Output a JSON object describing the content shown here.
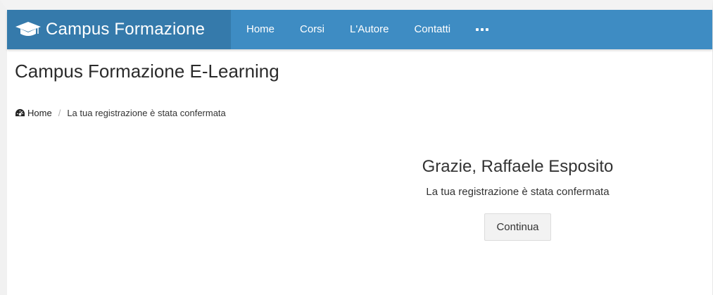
{
  "navbar": {
    "brand_icon": "graduation-cap-icon",
    "brand_text": "Campus Formazione",
    "links": [
      "Home",
      "Corsi",
      "L'Autore",
      "Contatti"
    ],
    "more_icon": "more-dots-icon",
    "colors": {
      "bar": "#3e8cc3",
      "brand_bg": "#357aab"
    }
  },
  "page": {
    "heading": "Campus Formazione E-Learning"
  },
  "breadcrumb": {
    "home_icon": "dashboard-icon",
    "home": "Home",
    "separator": "/",
    "current": "La tua registrazione è stata confermata"
  },
  "main": {
    "greeting": "Grazie, Raffaele Esposito",
    "message": "La tua registrazione è stata confermata",
    "continue_label": "Continua"
  }
}
